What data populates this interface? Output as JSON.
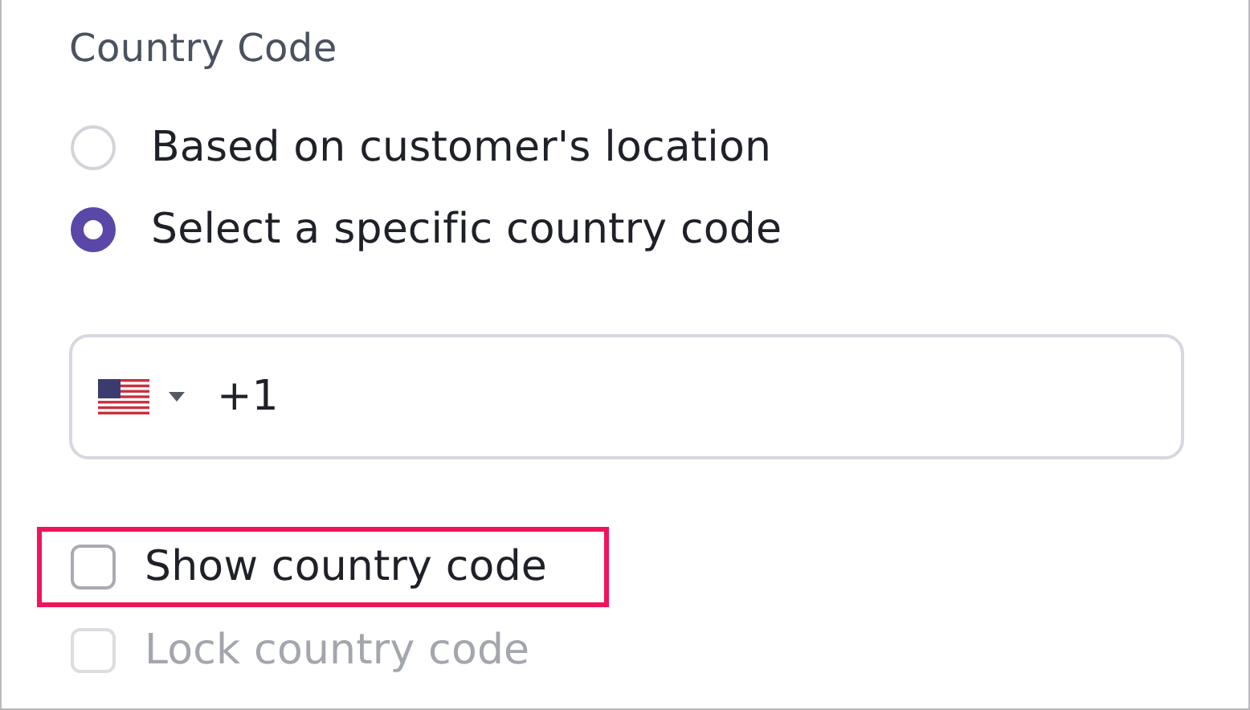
{
  "section": {
    "title": "Country Code"
  },
  "options": [
    {
      "label": "Based on customer's location",
      "selected": false
    },
    {
      "label": "Select a specific country code",
      "selected": true
    }
  ],
  "phone_field": {
    "value": "+1"
  },
  "checkboxes": [
    {
      "label": "Show country code",
      "checked": false,
      "disabled": false,
      "highlighted": true
    },
    {
      "label": "Lock country code",
      "checked": false,
      "disabled": true,
      "highlighted": false
    }
  ]
}
